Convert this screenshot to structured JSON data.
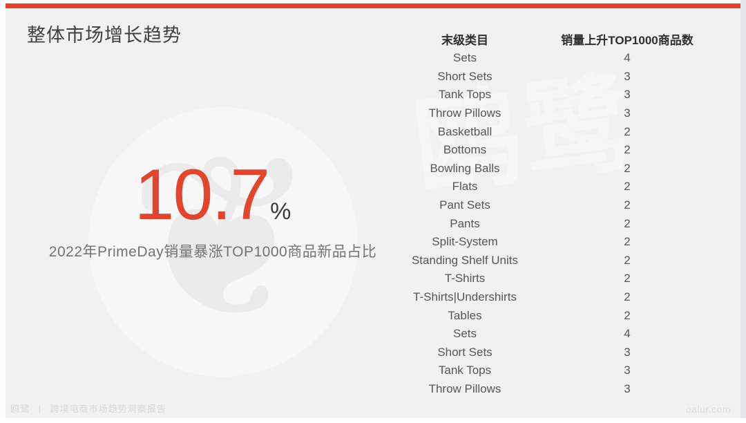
{
  "theme": {
    "accent_red": "#e8402a",
    "kpi_red": "#e2452c",
    "page_bg": "#f1f1f1",
    "text_dark": "#404040",
    "text_body": "#555555",
    "watermark_gray": "#f6f6f6"
  },
  "header": {
    "title": "整体市场增长趋势"
  },
  "kpi": {
    "value": "10.7",
    "unit": "%",
    "caption": "2022年PrimeDay销量暴涨TOP1000商品新品占比"
  },
  "watermark": {
    "brand_chars": "鸥鹭",
    "bird_glyph": "❦"
  },
  "table": {
    "columns": [
      "末级类目",
      "销量上升TOP1000商品数"
    ],
    "rows": [
      {
        "category": "Sets",
        "count": "4"
      },
      {
        "category": "Short Sets",
        "count": "3"
      },
      {
        "category": "Tank Tops",
        "count": "3"
      },
      {
        "category": "Throw Pillows",
        "count": "3"
      },
      {
        "category": "Basketball",
        "count": "2"
      },
      {
        "category": "Bottoms",
        "count": "2"
      },
      {
        "category": "Bowling Balls",
        "count": "2"
      },
      {
        "category": "Flats",
        "count": "2"
      },
      {
        "category": "Pant Sets",
        "count": "2"
      },
      {
        "category": "Pants",
        "count": "2"
      },
      {
        "category": "Split-System",
        "count": "2"
      },
      {
        "category": "Standing Shelf Units",
        "count": "2"
      },
      {
        "category": "T-Shirts",
        "count": "2"
      },
      {
        "category": "T-Shirts|Undershirts",
        "count": "2"
      },
      {
        "category": "Tables",
        "count": "2"
      },
      {
        "category": "Sets",
        "count": "4"
      },
      {
        "category": "Short Sets",
        "count": "3"
      },
      {
        "category": "Tank Tops",
        "count": "3"
      },
      {
        "category": "Throw Pillows",
        "count": "3"
      }
    ]
  },
  "footer": {
    "brand": "鸥鹭",
    "separator": "|",
    "report": "跨境电商市场趋势洞察报告",
    "site": "oalur.com"
  },
  "chart_data": {
    "type": "table",
    "title": "整体市场增长趋势",
    "columns": [
      "末级类目",
      "销量上升TOP1000商品数"
    ],
    "categories": [
      "Sets",
      "Short Sets",
      "Tank Tops",
      "Throw Pillows",
      "Basketball",
      "Bottoms",
      "Bowling Balls",
      "Flats",
      "Pant Sets",
      "Pants",
      "Split-System",
      "Standing Shelf Units",
      "T-Shirts",
      "T-Shirts|Undershirts",
      "Tables",
      "Sets",
      "Short Sets",
      "Tank Tops",
      "Throw Pillows"
    ],
    "values": [
      4,
      3,
      3,
      3,
      2,
      2,
      2,
      2,
      2,
      2,
      2,
      2,
      2,
      2,
      2,
      4,
      3,
      3,
      3
    ],
    "xlabel": "末级类目",
    "ylabel": "销量上升TOP1000商品数",
    "annotations": [
      {
        "label": "2022年PrimeDay销量暴涨TOP1000商品新品占比",
        "value": 10.7,
        "unit": "%"
      }
    ]
  }
}
